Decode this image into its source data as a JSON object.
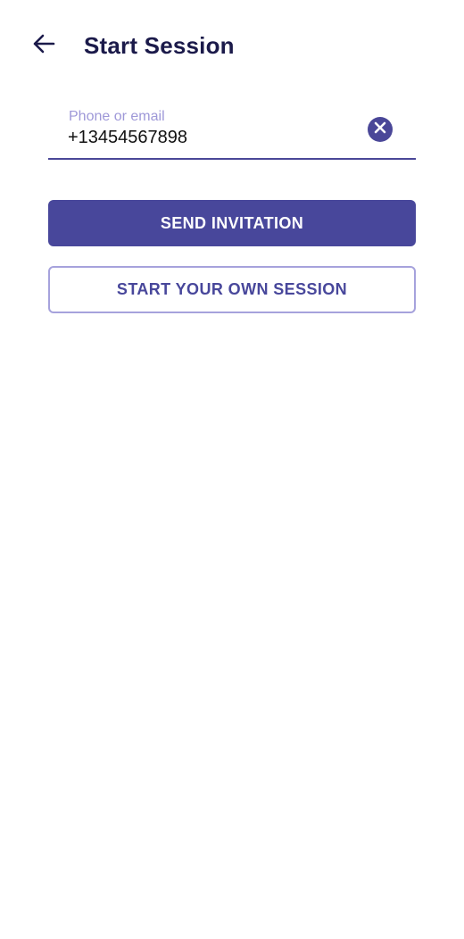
{
  "header": {
    "back_icon": "arrow-left-icon",
    "title": "Start Session"
  },
  "form": {
    "contact_label": "Phone or email",
    "contact_value": "+13454567898",
    "clear_icon": "close-circle-icon"
  },
  "actions": {
    "send_invitation_label": "SEND INVITATION",
    "start_own_session_label": "START YOUR OWN SESSION"
  },
  "colors": {
    "primary": "#48479b",
    "title": "#1b1a4a",
    "label": "#9e98d8",
    "outline_border": "#a6a2dc",
    "background": "#ffffff"
  }
}
